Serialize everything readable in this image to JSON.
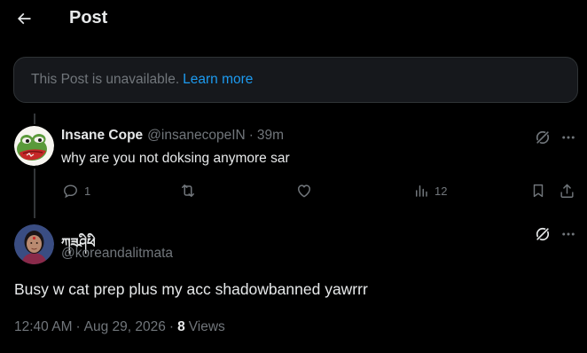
{
  "header": {
    "title": "Post"
  },
  "notice": {
    "text": "This Post is unavailable.",
    "link": "Learn more"
  },
  "reply": {
    "display_name": "Insane Cope",
    "handle": "@insanecopeIN",
    "separator": "·",
    "time": "39m",
    "text": "why are you not doksing anymore sar",
    "replies": "1",
    "views": "12"
  },
  "original": {
    "display_name": "ཀཟཤིཕི",
    "handle": "@koreandalitmata",
    "text": "Busy w cat prep plus my acc shadowbanned yawrrr",
    "time": "12:40 AM",
    "date": "Aug 29, 2026",
    "separator": "·",
    "views_count": "8",
    "views_label": "Views"
  },
  "colors": {
    "background": "#000000",
    "text_primary": "#e7e9ea",
    "text_secondary": "#71767b",
    "link": "#1d9bf0",
    "border": "#2f3336"
  }
}
